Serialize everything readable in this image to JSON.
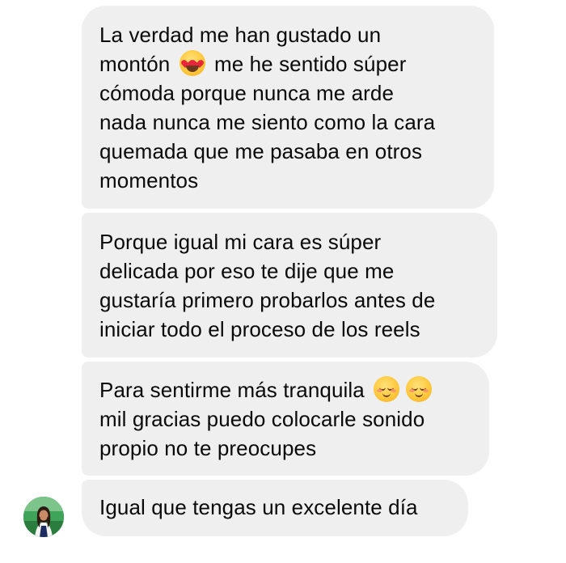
{
  "messages": [
    {
      "before": "La verdad me han gustado un\nmontón",
      "emoji": "smiling-face-with-heart-eyes-icon",
      "after": " me he sentido súper\ncómoda porque  nunca me arde\nnada nunca me siento como la cara\nquemada que me pasaba en otros\nmomentos"
    },
    {
      "text": "Porque igual mi cara es súper\ndelicada por eso te dije que me\ngustaría primero probarlos antes de\niniciar todo el proceso de los reels"
    },
    {
      "before": "Para sentirme más tranquila",
      "emoji": "smiling-face-icon",
      "after": "\nmil gracias puedo colocarle sonido\npropio no te preocupes"
    },
    {
      "text": "Igual que tengas un excelente día"
    }
  ],
  "colors": {
    "bubble_bg": "#efefef",
    "text": "#0a0a0a",
    "page_bg": "#ffffff"
  },
  "sender": {
    "avatar": "profile-avatar"
  }
}
